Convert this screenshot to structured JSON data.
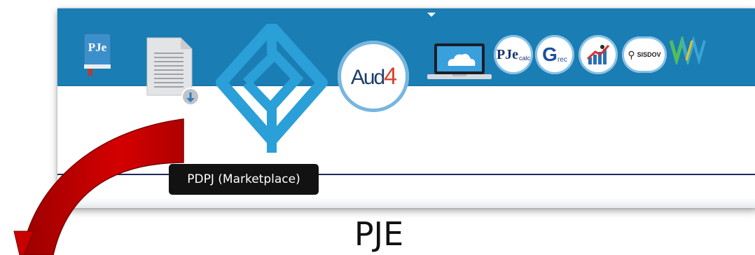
{
  "toolbar": {
    "pje_book_label": "PJe",
    "aud4_label": "Aud4",
    "aud4_number_color": "#d9432b",
    "pjecalc_label": "PJe",
    "pjecalc_sub": "calc",
    "grec_label": "G",
    "grec_sub": "rec",
    "sisdov_label": "SISDOV",
    "www_label": "W"
  },
  "tooltip": {
    "text": "PDPJ (Marketplace)"
  },
  "caption": {
    "text": "PJE"
  },
  "colors": {
    "header_blue": "#1a7db4",
    "logo_blue": "#2a9fd8",
    "arrow_red": "#cc0000",
    "tooltip_bg": "#121212"
  }
}
